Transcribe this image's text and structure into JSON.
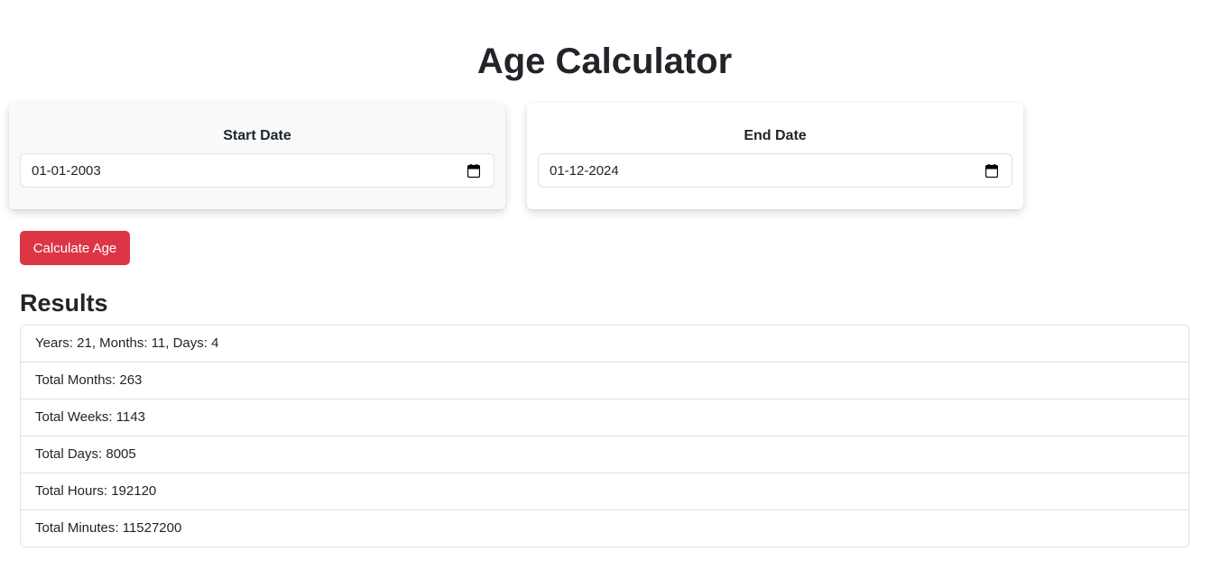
{
  "page": {
    "title": "Age Calculator"
  },
  "start_card": {
    "label": "Start Date",
    "value": "01-01-2003",
    "icon": "calendar-icon"
  },
  "end_card": {
    "label": "End Date",
    "value": "01-12-2024",
    "icon": "calendar-icon"
  },
  "calculate_button": {
    "label": "Calculate Age",
    "color": "#dc3545"
  },
  "results": {
    "heading": "Results",
    "items": [
      "Years: 21, Months: 11, Days: 4",
      "Total Months: 263",
      "Total Weeks: 1143",
      "Total Days: 8005",
      "Total Hours: 192120",
      "Total Minutes: 11527200"
    ]
  }
}
